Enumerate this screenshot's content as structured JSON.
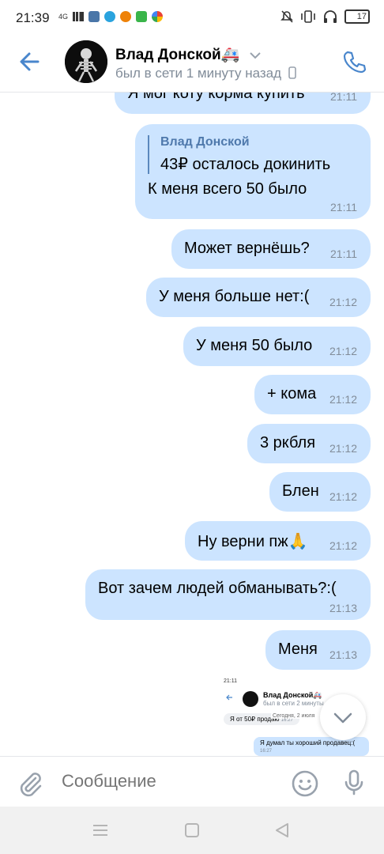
{
  "status_bar": {
    "time": "21:39",
    "network": "4G",
    "battery": "17"
  },
  "header": {
    "name": "Влад Донской",
    "name_emoji": "🚑",
    "status": "был в сети 1 минуту назад"
  },
  "messages": [
    {
      "text": "Я мог коту корма купить",
      "time": "21:11"
    },
    {
      "quote_author": "Влад Донской",
      "quote_text": "43₽ осталось докинить",
      "text": "К меня всего 50 было",
      "time": "21:11"
    },
    {
      "text": "Может вернёшь?",
      "time": "21:11"
    },
    {
      "text": "У меня больше нет:(",
      "time": "21:12"
    },
    {
      "text": "У меня 50 было",
      "time": "21:12"
    },
    {
      "text": "+ кома",
      "time": "21:12"
    },
    {
      "text": "3 ркбля",
      "time": "21:12"
    },
    {
      "text": "Блен",
      "time": "21:12"
    },
    {
      "text": "Ну верни пж🙏",
      "time": "21:12"
    },
    {
      "text": "Вот зачем людей обманывать?:(",
      "time": "21:13"
    },
    {
      "text": "Меня",
      "time": "21:13"
    }
  ],
  "thumbnail": {
    "time": "21:11",
    "name": "Влад Донской🚑",
    "status": "был в сети 2 минуты",
    "date": "Сегодня, 2 июля",
    "incoming": "Я от 50₽ продаю",
    "incoming_time": "16:27",
    "outgoing": "Я думал ты хороший продавец:(",
    "outgoing_time": "16:27"
  },
  "composer": {
    "placeholder": "Сообщение"
  },
  "colors": {
    "accent": "#4986cc",
    "bubble_out": "#cce4ff",
    "secondary_text": "#818c99"
  },
  "icons": [
    "back-arrow-icon",
    "phone-icon",
    "attach-icon",
    "emoji-icon",
    "mic-icon",
    "chevron-down-icon"
  ]
}
